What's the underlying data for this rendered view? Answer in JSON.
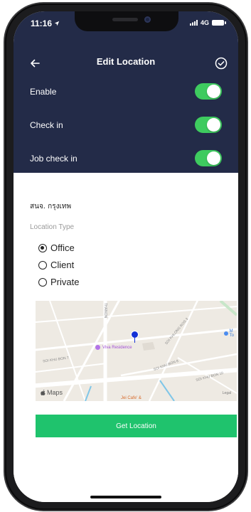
{
  "status_bar": {
    "time": "11:16",
    "network": "4G"
  },
  "navbar": {
    "title": "Edit Location",
    "back_icon": "arrow-left-icon",
    "done_icon": "check-circle-icon"
  },
  "toggles": [
    {
      "label": "Enable",
      "on": true
    },
    {
      "label": "Check in",
      "on": true
    },
    {
      "label": "Job check in",
      "on": true
    }
  ],
  "location": {
    "place_name": "สนจ. กรุงเทพ",
    "type_label": "Location Type",
    "types": [
      {
        "label": "Office",
        "selected": true
      },
      {
        "label": "Client",
        "selected": false
      },
      {
        "label": "Private",
        "selected": false
      }
    ]
  },
  "map": {
    "poi_name": "Viva Residence",
    "cafe_name": "Jei Cafe' &",
    "maps_label": "Maps",
    "legal_label": "Legal",
    "road_labels": [
      "THANON",
      "SOI KHLONG ROS 3",
      "SOI KHU BON 7",
      "SOI KHU BON 8",
      "SOI KHU BON 10"
    ],
    "corner_label": "M\nTo"
  },
  "button": {
    "get_location": "Get Location"
  },
  "colors": {
    "header_bg": "#232b48",
    "toggle_on": "#3ecb5f",
    "button_bg": "#1fc36d",
    "pin": "#1432d6"
  }
}
